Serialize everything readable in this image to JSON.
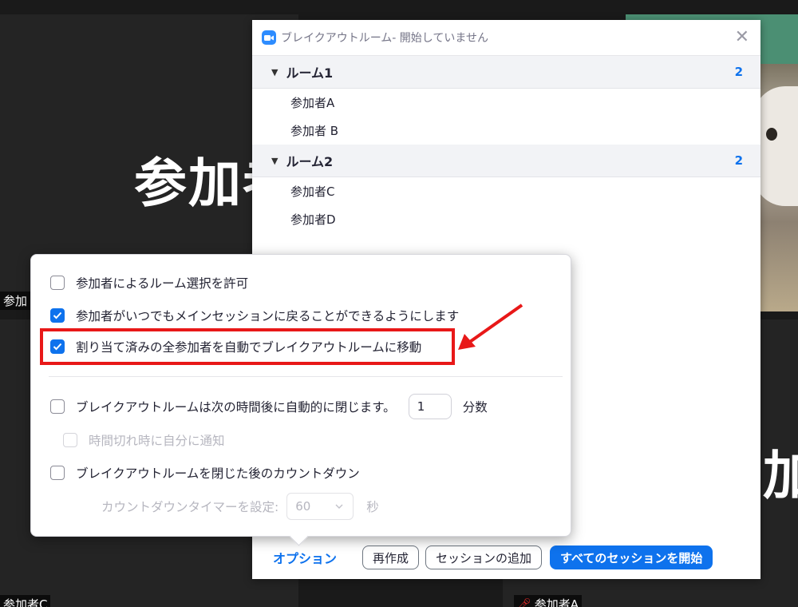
{
  "background": {
    "tile1_name": "参加者",
    "tile1_label": "参加",
    "tile2_label": "参加者C",
    "tile3_name": "加者",
    "tile3_label": "参加者A"
  },
  "dialog": {
    "title": "ブレイクアウトルーム- 開始していません",
    "rooms": [
      {
        "name": "ルーム1",
        "count": "2",
        "participants": [
          "参加者A",
          "参加者 B"
        ]
      },
      {
        "name": "ルーム2",
        "count": "2",
        "participants": [
          "参加者C",
          "参加者D"
        ]
      }
    ],
    "footer": {
      "options_label": "オプション",
      "recreate_label": "再作成",
      "add_session_label": "セッションの追加",
      "start_all_label": "すべてのセッションを開始"
    }
  },
  "options": {
    "allow_room_select": {
      "label": "参加者によるルーム選択を許可",
      "checked": false
    },
    "allow_return": {
      "label": "参加者がいつでもメインセッションに戻ることができるようにします",
      "checked": true
    },
    "auto_move": {
      "label": "割り当て済みの全参加者を自動でブレイクアウトルームに移動",
      "checked": true
    },
    "auto_close": {
      "label": "ブレイクアウトルームは次の時間後に自動的に閉じます。",
      "checked": false,
      "value": "1",
      "unit": "分数"
    },
    "notify_on_timeout": {
      "label": "時間切れ時に自分に通知",
      "checked": false,
      "disabled": true
    },
    "countdown": {
      "label": "ブレイクアウトルームを閉じた後のカウントダウン",
      "checked": false
    },
    "countdown_timer": {
      "label": "カウントダウンタイマーを設定:",
      "value": "60",
      "unit": "秒"
    }
  },
  "colors": {
    "accent": "#0e72ed",
    "highlight": "#e81818"
  }
}
